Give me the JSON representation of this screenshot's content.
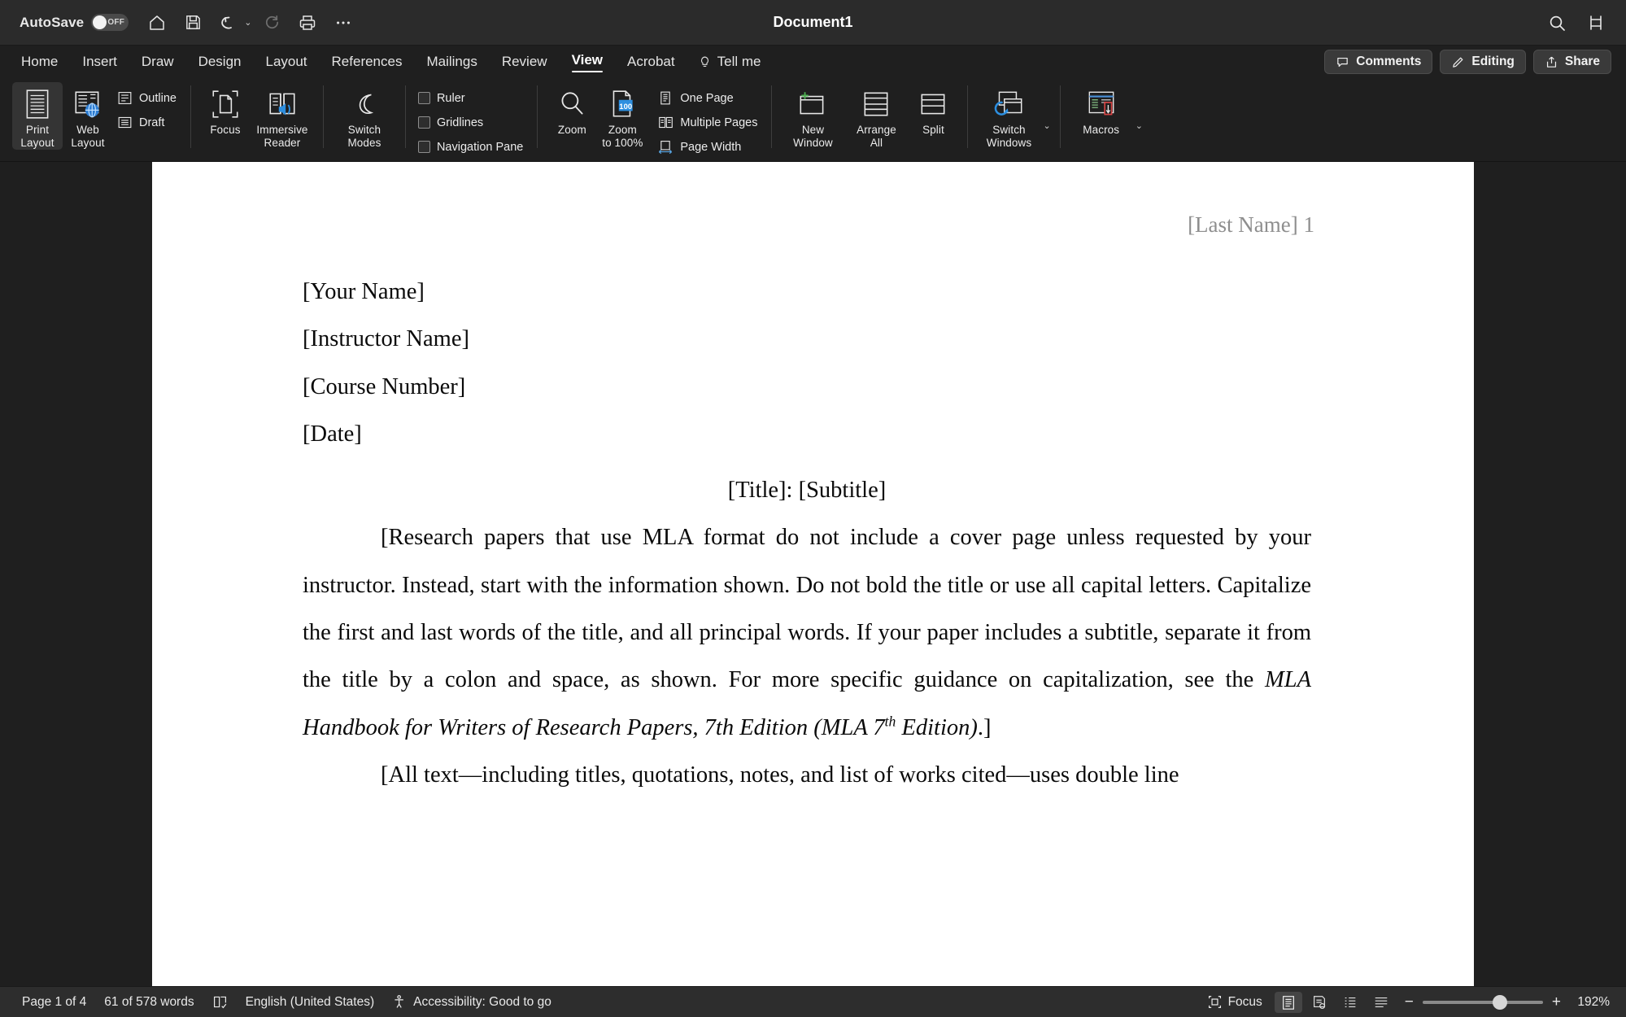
{
  "titlebar": {
    "autosave_label": "AutoSave",
    "autosave_state": "OFF",
    "document_title": "Document1",
    "quick_access": [
      {
        "name": "home-icon",
        "label": "Home"
      },
      {
        "name": "save-icon",
        "label": "Save"
      },
      {
        "name": "undo-icon",
        "label": "Undo"
      },
      {
        "name": "undo-dropdown-icon",
        "label": "Undo options"
      },
      {
        "name": "redo-icon",
        "label": "Redo"
      },
      {
        "name": "print-icon",
        "label": "Print"
      },
      {
        "name": "more-icon",
        "label": "More"
      }
    ],
    "right_icons": [
      {
        "name": "search-icon",
        "label": "Search"
      },
      {
        "name": "ribbon-display-icon",
        "label": "Ribbon Display Options"
      }
    ]
  },
  "tabs": [
    {
      "label": "Home",
      "active": false
    },
    {
      "label": "Insert",
      "active": false
    },
    {
      "label": "Draw",
      "active": false
    },
    {
      "label": "Design",
      "active": false
    },
    {
      "label": "Layout",
      "active": false
    },
    {
      "label": "References",
      "active": false
    },
    {
      "label": "Mailings",
      "active": false
    },
    {
      "label": "Review",
      "active": false
    },
    {
      "label": "View",
      "active": true
    },
    {
      "label": "Acrobat",
      "active": false
    }
  ],
  "tell_me": "Tell me",
  "tab_actions": [
    {
      "label": "Comments",
      "icon": "comment-icon"
    },
    {
      "label": "Editing",
      "icon": "pencil-icon"
    },
    {
      "label": "Share",
      "icon": "share-icon"
    }
  ],
  "ribbon": {
    "views": [
      {
        "label_line1": "Print",
        "label_line2": "Layout",
        "icon": "print-layout-icon",
        "selected": true
      },
      {
        "label_line1": "Web",
        "label_line2": "Layout",
        "icon": "web-layout-icon",
        "selected": false
      }
    ],
    "views_small": [
      {
        "label": "Outline",
        "icon": "outline-icon"
      },
      {
        "label": "Draft",
        "icon": "draft-icon"
      }
    ],
    "immersive": [
      {
        "label_line1": "Focus",
        "label_line2": "",
        "icon": "focus-icon"
      },
      {
        "label_line1": "Immersive",
        "label_line2": "Reader",
        "icon": "immersive-reader-icon"
      }
    ],
    "switch_modes": {
      "label_line1": "Switch",
      "label_line2": "Modes",
      "icon": "moon-icon"
    },
    "show": [
      {
        "label": "Ruler",
        "checked": false
      },
      {
        "label": "Gridlines",
        "checked": false
      },
      {
        "label": "Navigation Pane",
        "checked": false
      }
    ],
    "zoom_group": [
      {
        "label_line1": "Zoom",
        "label_line2": "",
        "icon": "magnifier-icon"
      },
      {
        "label_line1": "Zoom",
        "label_line2": "to 100%",
        "icon": "zoom-100-icon"
      }
    ],
    "page_views": [
      {
        "label": "One Page",
        "icon": "one-page-icon"
      },
      {
        "label": "Multiple Pages",
        "icon": "multiple-pages-icon"
      },
      {
        "label": "Page Width",
        "icon": "page-width-icon"
      }
    ],
    "window": [
      {
        "label_line1": "New",
        "label_line2": "Window",
        "icon": "new-window-icon"
      },
      {
        "label_line1": "Arrange",
        "label_line2": "All",
        "icon": "arrange-all-icon"
      },
      {
        "label_line1": "Split",
        "label_line2": "",
        "icon": "split-icon"
      },
      {
        "label_line1": "Switch",
        "label_line2": "Windows",
        "icon": "switch-windows-icon"
      }
    ],
    "macros": {
      "label_line1": "Macros",
      "label_line2": "",
      "icon": "macros-icon"
    }
  },
  "document": {
    "page_header": "[Last Name] 1",
    "lines": [
      {
        "id": "name",
        "text": "[Your Name]"
      },
      {
        "id": "instructor",
        "text": "[Instructor Name]"
      },
      {
        "id": "course",
        "text": "[Course Number]"
      },
      {
        "id": "date",
        "text": "[Date]"
      },
      {
        "id": "title",
        "text": "[Title]: [Subtitle]"
      }
    ],
    "paragraph1_part1": "[Research papers that use MLA format do not include a cover page unless requested by your instructor. Instead, start with the information shown. Do not bold the title or use all capital letters. Capitalize the first and last words of the title, and all principal words. If your paper includes a subtitle, separate it from the title by a colon and space, as shown. For more specific guidance on capitalization, see the ",
    "paragraph1_italic1": "MLA Handbook for Writers of Research Papers, 7th Edition (MLA 7",
    "paragraph1_sup": "th",
    "paragraph1_italic2": " Edition)",
    "paragraph1_part2": ".]",
    "paragraph2": "[All text—including titles, quotations, notes, and list of works cited—uses double line"
  },
  "statusbar": {
    "page_info": "Page 1 of 4",
    "word_count": "61 of 578 words",
    "proofing_icon": "proofing-icon",
    "language": "English (United States)",
    "accessibility": "Accessibility: Good to go",
    "focus_label": "Focus",
    "view_buttons": [
      {
        "name": "read-mode-icon",
        "selected": true
      },
      {
        "name": "print-layout-view-icon",
        "selected": false
      },
      {
        "name": "web-layout-view-icon",
        "selected": false
      },
      {
        "name": "outline-view-icon",
        "selected": false
      }
    ],
    "zoom_out": "−",
    "zoom_in": "+",
    "zoom_level": "192%"
  },
  "colors": {
    "chrome": "#1f1f1f",
    "titlebar": "#2b2b2b",
    "statusbar": "#2d2d2d",
    "page": "#ffffff",
    "accent": "#2b7cd3"
  }
}
